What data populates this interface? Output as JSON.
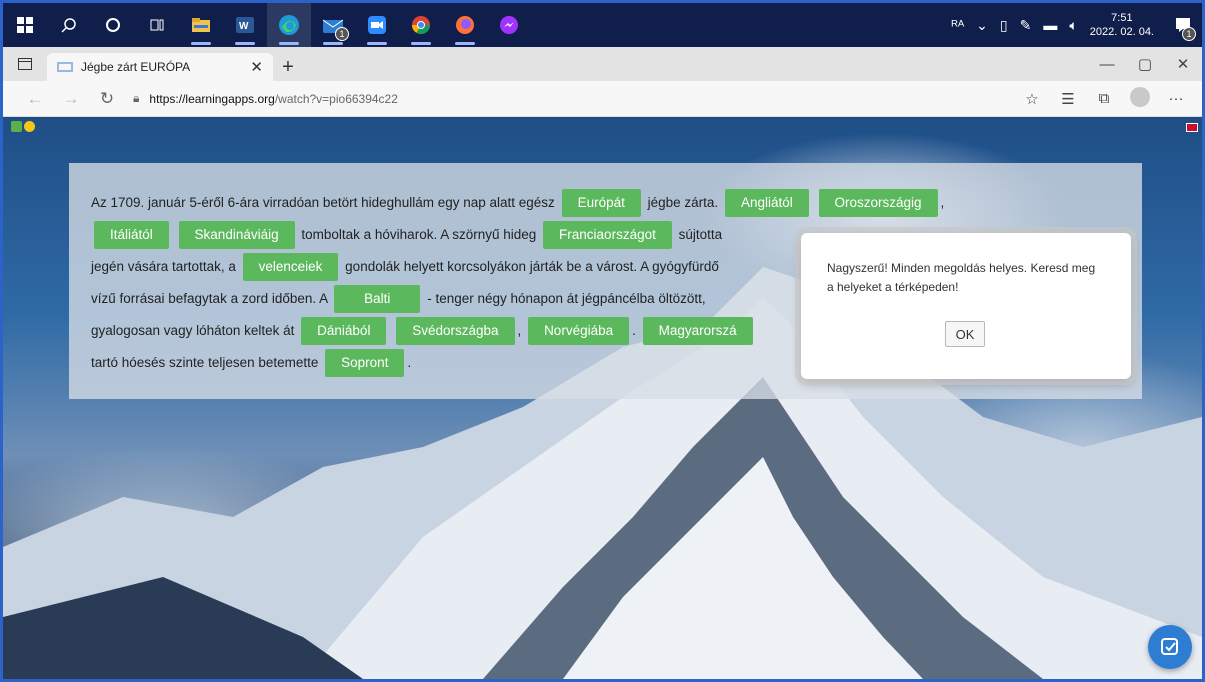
{
  "taskbar": {
    "apps": [
      "start-icon",
      "search-icon",
      "cortana-icon",
      "task-view-icon",
      "file-explorer-icon",
      "word-icon",
      "edge-icon",
      "mail-icon",
      "zoom-icon",
      "chrome-icon",
      "firefox-icon",
      "messenger-icon"
    ],
    "mail_badge": "1",
    "clock_time": "7:51",
    "clock_date": "2022. 02. 04.",
    "notification_badge": "1"
  },
  "browser": {
    "tab_title": "Jégbe zárt EURÓPA",
    "url_domain": "https://learningapps.org",
    "url_path": "/watch?v=pio66394c22"
  },
  "exercise": {
    "t1": "Az 1709. január 5-éről 6-ára virradóan betört hideghullám egy nap alatt egész",
    "c_europat": "Európát",
    "t2": "jégbe zárta.",
    "c_angliatol": "Angliától",
    "c_oroszorszagig": "Oroszországig",
    "t3": ",",
    "c_italiatol": "Itáliától",
    "c_skandinaviaig": "Skandináviáig",
    "t4": "tomboltak a hóviharok. A szörnyű hideg",
    "c_franciaorszagot": "Franciaországot",
    "t5": "sújtotta",
    "t6": "jegén vására tartottak, a",
    "c_velenceiek": "velenceiek",
    "t7": "gondolák helyett korcsolyákon járták be a várost. A gyógyfürdő",
    "t8": "vízű forrásai befagytak a zord időben. A",
    "c_balti": "Balti",
    "t9": "- tenger négy hónapon át jégpáncélba öltözött,",
    "t10": "gyalogosan vagy lóháton keltek át",
    "c_daniabol": "Dániából",
    "c_svedorszagba": "Svédországba",
    "t11": ",",
    "c_norvegiaba": "Norvégiába",
    "t12": ".",
    "c_magyarorsza": "Magyarorszá",
    "t13": "tartó hóesés szinte teljesen betemette",
    "c_sopront": "Sopront",
    "t14": "."
  },
  "dialog": {
    "message": "Nagyszerű! Minden megoldás helyes. Keresd meg a helyeket a térképeden!",
    "ok_label": "OK"
  },
  "colors": {
    "chip": "#5cb85c",
    "taskbar": "#0f1e4a",
    "check_button": "#2d7dd2"
  }
}
